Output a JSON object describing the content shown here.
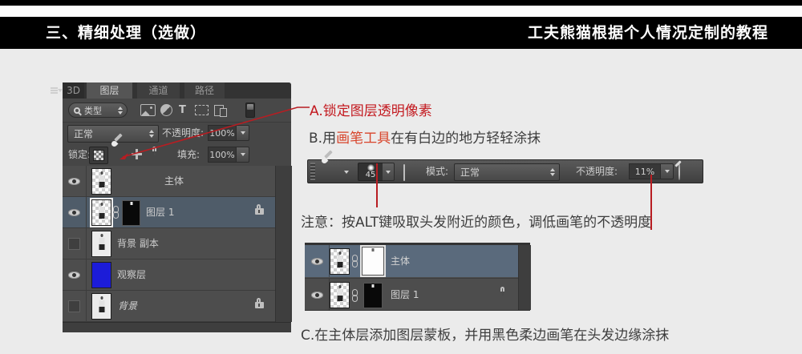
{
  "header": {
    "section_title": "三、精细处理（选做）",
    "credit": "工夫熊猫根据个人情况定制的教程"
  },
  "layers_panel": {
    "tabs": [
      {
        "label": "3D",
        "active": false
      },
      {
        "label": "图层",
        "active": true
      },
      {
        "label": "通道",
        "active": false
      },
      {
        "label": "路径",
        "active": false
      }
    ],
    "filter_type_label": "类型",
    "blend_mode_value": "正常",
    "opacity_label": "不透明度:",
    "opacity_value": "100%",
    "lock_label": "锁定:",
    "fill_label": "填充:",
    "fill_value": "100%",
    "layers": [
      {
        "name": "主体",
        "visible": true,
        "selected": false,
        "locked": false
      },
      {
        "name": "图层 1",
        "visible": true,
        "selected": true,
        "locked": true
      },
      {
        "name": "背景 副本",
        "visible": false,
        "selected": false,
        "locked": false
      },
      {
        "name": "观察层",
        "visible": true,
        "selected": false,
        "locked": false
      },
      {
        "name": "背景",
        "visible": false,
        "selected": false,
        "locked": true
      }
    ]
  },
  "annotation_a": {
    "text": "A.锁定图层透明像素"
  },
  "annotation_b": {
    "prefix": "B.用",
    "highlight": "画笔工具",
    "suffix": "在有白边的地方轻轻涂抹"
  },
  "brush_bar": {
    "size_value": "45",
    "mode_label": "模式:",
    "mode_value": "正常",
    "opacity_label": "不透明度:",
    "opacity_value": "11%"
  },
  "note_line": {
    "text": "注意：按ALT键吸取头发附近的颜色，调低画笔的不透明度"
  },
  "mini_panel": {
    "layers": [
      {
        "name": "主体",
        "visible": true,
        "selected": true,
        "locked": false
      },
      {
        "name": "图层 1",
        "visible": true,
        "selected": false,
        "locked": true
      }
    ]
  },
  "annotation_c": {
    "text": "C.在主体层添加图层蒙板，并用黑色柔边画笔在头发边缘涂抹"
  },
  "icons": {
    "text_tool_glyph": "T"
  },
  "colors": {
    "accent_red": "#b81d22",
    "highlight_orange": "#d8442b",
    "selected_row": "#4f5c69",
    "selected_row_mini": "#5a6a7c",
    "observe_layer_blue": "#1c1cd8",
    "page_background": "#ebebeb",
    "panel_background": "#4d4d4d"
  }
}
